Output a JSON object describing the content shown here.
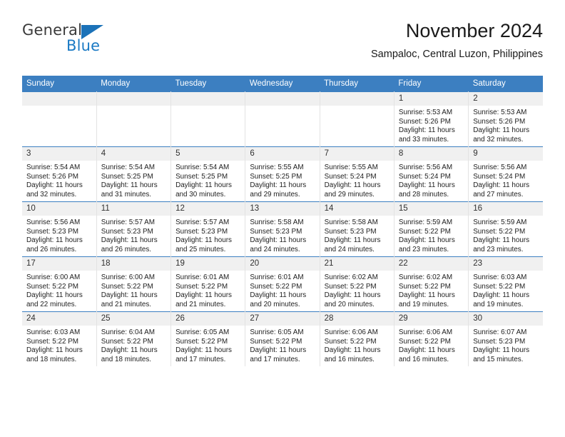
{
  "brand": {
    "name_top": "General",
    "name_bottom": "Blue",
    "triangle_color": "#1b72b8",
    "blue_color": "#1b7ac4"
  },
  "header": {
    "title": "November 2024",
    "subtitle": "Sampaloc, Central Luzon, Philippines"
  },
  "theme": {
    "header_bg": "#3c7fc1",
    "daynum_bg": "#f0f0f0",
    "grid_line": "#e3e3e3"
  },
  "weekdays": [
    "Sunday",
    "Monday",
    "Tuesday",
    "Wednesday",
    "Thursday",
    "Friday",
    "Saturday"
  ],
  "weeks": [
    [
      {
        "day": "",
        "lines": []
      },
      {
        "day": "",
        "lines": []
      },
      {
        "day": "",
        "lines": []
      },
      {
        "day": "",
        "lines": []
      },
      {
        "day": "",
        "lines": []
      },
      {
        "day": "1",
        "lines": [
          "Sunrise: 5:53 AM",
          "Sunset: 5:26 PM",
          "Daylight: 11 hours",
          "and 33 minutes."
        ]
      },
      {
        "day": "2",
        "lines": [
          "Sunrise: 5:53 AM",
          "Sunset: 5:26 PM",
          "Daylight: 11 hours",
          "and 32 minutes."
        ]
      }
    ],
    [
      {
        "day": "3",
        "lines": [
          "Sunrise: 5:54 AM",
          "Sunset: 5:26 PM",
          "Daylight: 11 hours",
          "and 32 minutes."
        ]
      },
      {
        "day": "4",
        "lines": [
          "Sunrise: 5:54 AM",
          "Sunset: 5:25 PM",
          "Daylight: 11 hours",
          "and 31 minutes."
        ]
      },
      {
        "day": "5",
        "lines": [
          "Sunrise: 5:54 AM",
          "Sunset: 5:25 PM",
          "Daylight: 11 hours",
          "and 30 minutes."
        ]
      },
      {
        "day": "6",
        "lines": [
          "Sunrise: 5:55 AM",
          "Sunset: 5:25 PM",
          "Daylight: 11 hours",
          "and 29 minutes."
        ]
      },
      {
        "day": "7",
        "lines": [
          "Sunrise: 5:55 AM",
          "Sunset: 5:24 PM",
          "Daylight: 11 hours",
          "and 29 minutes."
        ]
      },
      {
        "day": "8",
        "lines": [
          "Sunrise: 5:56 AM",
          "Sunset: 5:24 PM",
          "Daylight: 11 hours",
          "and 28 minutes."
        ]
      },
      {
        "day": "9",
        "lines": [
          "Sunrise: 5:56 AM",
          "Sunset: 5:24 PM",
          "Daylight: 11 hours",
          "and 27 minutes."
        ]
      }
    ],
    [
      {
        "day": "10",
        "lines": [
          "Sunrise: 5:56 AM",
          "Sunset: 5:23 PM",
          "Daylight: 11 hours",
          "and 26 minutes."
        ]
      },
      {
        "day": "11",
        "lines": [
          "Sunrise: 5:57 AM",
          "Sunset: 5:23 PM",
          "Daylight: 11 hours",
          "and 26 minutes."
        ]
      },
      {
        "day": "12",
        "lines": [
          "Sunrise: 5:57 AM",
          "Sunset: 5:23 PM",
          "Daylight: 11 hours",
          "and 25 minutes."
        ]
      },
      {
        "day": "13",
        "lines": [
          "Sunrise: 5:58 AM",
          "Sunset: 5:23 PM",
          "Daylight: 11 hours",
          "and 24 minutes."
        ]
      },
      {
        "day": "14",
        "lines": [
          "Sunrise: 5:58 AM",
          "Sunset: 5:23 PM",
          "Daylight: 11 hours",
          "and 24 minutes."
        ]
      },
      {
        "day": "15",
        "lines": [
          "Sunrise: 5:59 AM",
          "Sunset: 5:22 PM",
          "Daylight: 11 hours",
          "and 23 minutes."
        ]
      },
      {
        "day": "16",
        "lines": [
          "Sunrise: 5:59 AM",
          "Sunset: 5:22 PM",
          "Daylight: 11 hours",
          "and 23 minutes."
        ]
      }
    ],
    [
      {
        "day": "17",
        "lines": [
          "Sunrise: 6:00 AM",
          "Sunset: 5:22 PM",
          "Daylight: 11 hours",
          "and 22 minutes."
        ]
      },
      {
        "day": "18",
        "lines": [
          "Sunrise: 6:00 AM",
          "Sunset: 5:22 PM",
          "Daylight: 11 hours",
          "and 21 minutes."
        ]
      },
      {
        "day": "19",
        "lines": [
          "Sunrise: 6:01 AM",
          "Sunset: 5:22 PM",
          "Daylight: 11 hours",
          "and 21 minutes."
        ]
      },
      {
        "day": "20",
        "lines": [
          "Sunrise: 6:01 AM",
          "Sunset: 5:22 PM",
          "Daylight: 11 hours",
          "and 20 minutes."
        ]
      },
      {
        "day": "21",
        "lines": [
          "Sunrise: 6:02 AM",
          "Sunset: 5:22 PM",
          "Daylight: 11 hours",
          "and 20 minutes."
        ]
      },
      {
        "day": "22",
        "lines": [
          "Sunrise: 6:02 AM",
          "Sunset: 5:22 PM",
          "Daylight: 11 hours",
          "and 19 minutes."
        ]
      },
      {
        "day": "23",
        "lines": [
          "Sunrise: 6:03 AM",
          "Sunset: 5:22 PM",
          "Daylight: 11 hours",
          "and 19 minutes."
        ]
      }
    ],
    [
      {
        "day": "24",
        "lines": [
          "Sunrise: 6:03 AM",
          "Sunset: 5:22 PM",
          "Daylight: 11 hours",
          "and 18 minutes."
        ]
      },
      {
        "day": "25",
        "lines": [
          "Sunrise: 6:04 AM",
          "Sunset: 5:22 PM",
          "Daylight: 11 hours",
          "and 18 minutes."
        ]
      },
      {
        "day": "26",
        "lines": [
          "Sunrise: 6:05 AM",
          "Sunset: 5:22 PM",
          "Daylight: 11 hours",
          "and 17 minutes."
        ]
      },
      {
        "day": "27",
        "lines": [
          "Sunrise: 6:05 AM",
          "Sunset: 5:22 PM",
          "Daylight: 11 hours",
          "and 17 minutes."
        ]
      },
      {
        "day": "28",
        "lines": [
          "Sunrise: 6:06 AM",
          "Sunset: 5:22 PM",
          "Daylight: 11 hours",
          "and 16 minutes."
        ]
      },
      {
        "day": "29",
        "lines": [
          "Sunrise: 6:06 AM",
          "Sunset: 5:22 PM",
          "Daylight: 11 hours",
          "and 16 minutes."
        ]
      },
      {
        "day": "30",
        "lines": [
          "Sunrise: 6:07 AM",
          "Sunset: 5:23 PM",
          "Daylight: 11 hours",
          "and 15 minutes."
        ]
      }
    ]
  ]
}
